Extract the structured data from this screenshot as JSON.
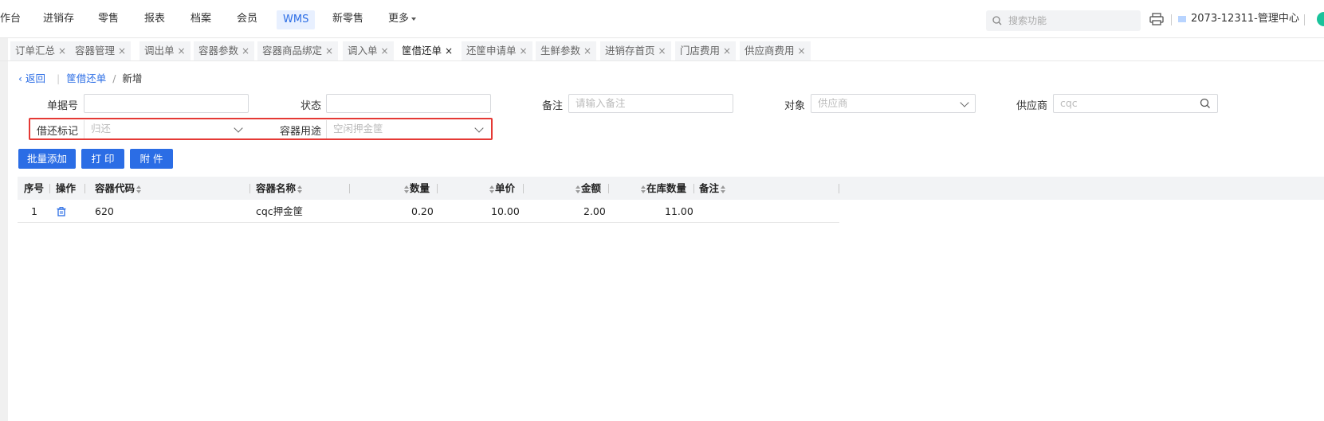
{
  "nav": {
    "items": [
      "作台",
      "进销存",
      "零售",
      "报表",
      "档案",
      "会员",
      "WMS",
      "新零售",
      "更多"
    ],
    "active": "WMS",
    "search_placeholder": "搜索功能",
    "store_label": "2073-12311-管理中心"
  },
  "tabs": [
    {
      "label": "订单汇总"
    },
    {
      "label": "容器管理"
    },
    {
      "label": "调出单"
    },
    {
      "label": "容器参数"
    },
    {
      "label": "容器商品绑定"
    },
    {
      "label": "调入单"
    },
    {
      "label": "筐借还单",
      "active": true
    },
    {
      "label": "还筐申请单"
    },
    {
      "label": "生鲜参数"
    },
    {
      "label": "进销存首页"
    },
    {
      "label": "门店费用"
    },
    {
      "label": "供应商费用"
    }
  ],
  "tab_close": "×",
  "breadcrumb": {
    "back": "返回",
    "parent": "筐借还单",
    "sep": "/",
    "current": "新增"
  },
  "form": {
    "doc_no_label": "单据号",
    "doc_no_value": "",
    "status_label": "状态",
    "status_value": "",
    "remark_label": "备注",
    "remark_placeholder": "请输入备注",
    "target_label": "对象",
    "target_value": "供应商",
    "supplier_label": "供应商",
    "supplier_value": "cqc",
    "borrow_flag_label": "借还标记",
    "borrow_flag_value": "归还",
    "container_use_label": "容器用途",
    "container_use_value": "空闲押金筐"
  },
  "buttons": {
    "batch_add": "批量添加",
    "print": "打 印",
    "attachment": "附 件"
  },
  "table": {
    "headers": [
      "序号",
      "操作",
      "容器代码",
      "容器名称",
      "数量",
      "单价",
      "金额",
      "在库数量",
      "备注"
    ],
    "rows": [
      {
        "seq": "1",
        "code": "620",
        "name": "cqc押金筐",
        "qty": "0.20",
        "price": "10.00",
        "amount": "2.00",
        "stock": "11.00",
        "remark": ""
      }
    ]
  },
  "colors": {
    "accent": "#2b6de5",
    "highlight_box": "#e53935"
  }
}
